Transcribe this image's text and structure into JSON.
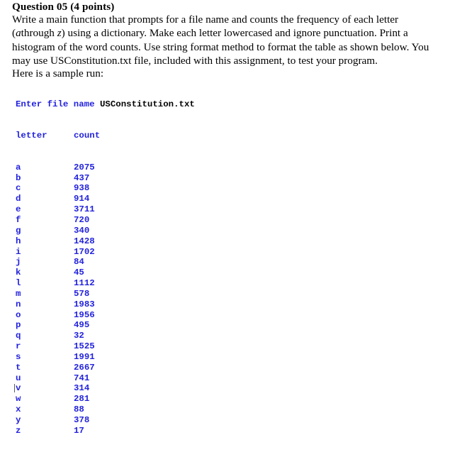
{
  "question": {
    "title": "Question 05 (4 points)",
    "body_part1": "Write a main function that prompts for a file name and counts the frequency of each letter (",
    "italic1": "a",
    "body_part2": "through ",
    "italic2": "z",
    "body_part3": ") using a dictionary. Make each letter lowercased and ignore punctuation. Print a histogram of the word counts. Use string format method to format the table as shown below. You may use USConstitution.txt file, included with this assignment, to test your program.",
    "sample_run_label": "Here is a sample run:"
  },
  "console": {
    "prompt_label": "Enter file name",
    "user_input": "USConstitution.txt",
    "header_letter": "letter",
    "header_count": "count",
    "text_color": "#2222dd",
    "input_color": "#000000",
    "rows": [
      {
        "letter": "a",
        "count": "2075"
      },
      {
        "letter": "b",
        "count": "437"
      },
      {
        "letter": "c",
        "count": "938"
      },
      {
        "letter": "d",
        "count": "914"
      },
      {
        "letter": "e",
        "count": "3711"
      },
      {
        "letter": "f",
        "count": "720"
      },
      {
        "letter": "g",
        "count": "340"
      },
      {
        "letter": "h",
        "count": "1428"
      },
      {
        "letter": "i",
        "count": "1702"
      },
      {
        "letter": "j",
        "count": "84"
      },
      {
        "letter": "k",
        "count": "45"
      },
      {
        "letter": "l",
        "count": "1112"
      },
      {
        "letter": "m",
        "count": "578"
      },
      {
        "letter": "n",
        "count": "1983"
      },
      {
        "letter": "o",
        "count": "1956"
      },
      {
        "letter": "p",
        "count": "495"
      },
      {
        "letter": "q",
        "count": "32"
      },
      {
        "letter": "r",
        "count": "1525"
      },
      {
        "letter": "s",
        "count": "1991"
      },
      {
        "letter": "t",
        "count": "2667"
      },
      {
        "letter": "u",
        "count": "741"
      },
      {
        "letter": "v",
        "count": "314"
      },
      {
        "letter": "w",
        "count": "281"
      },
      {
        "letter": "x",
        "count": "88"
      },
      {
        "letter": "y",
        "count": "378"
      },
      {
        "letter": "z",
        "count": "17"
      }
    ],
    "caret_row_letter": "v"
  }
}
